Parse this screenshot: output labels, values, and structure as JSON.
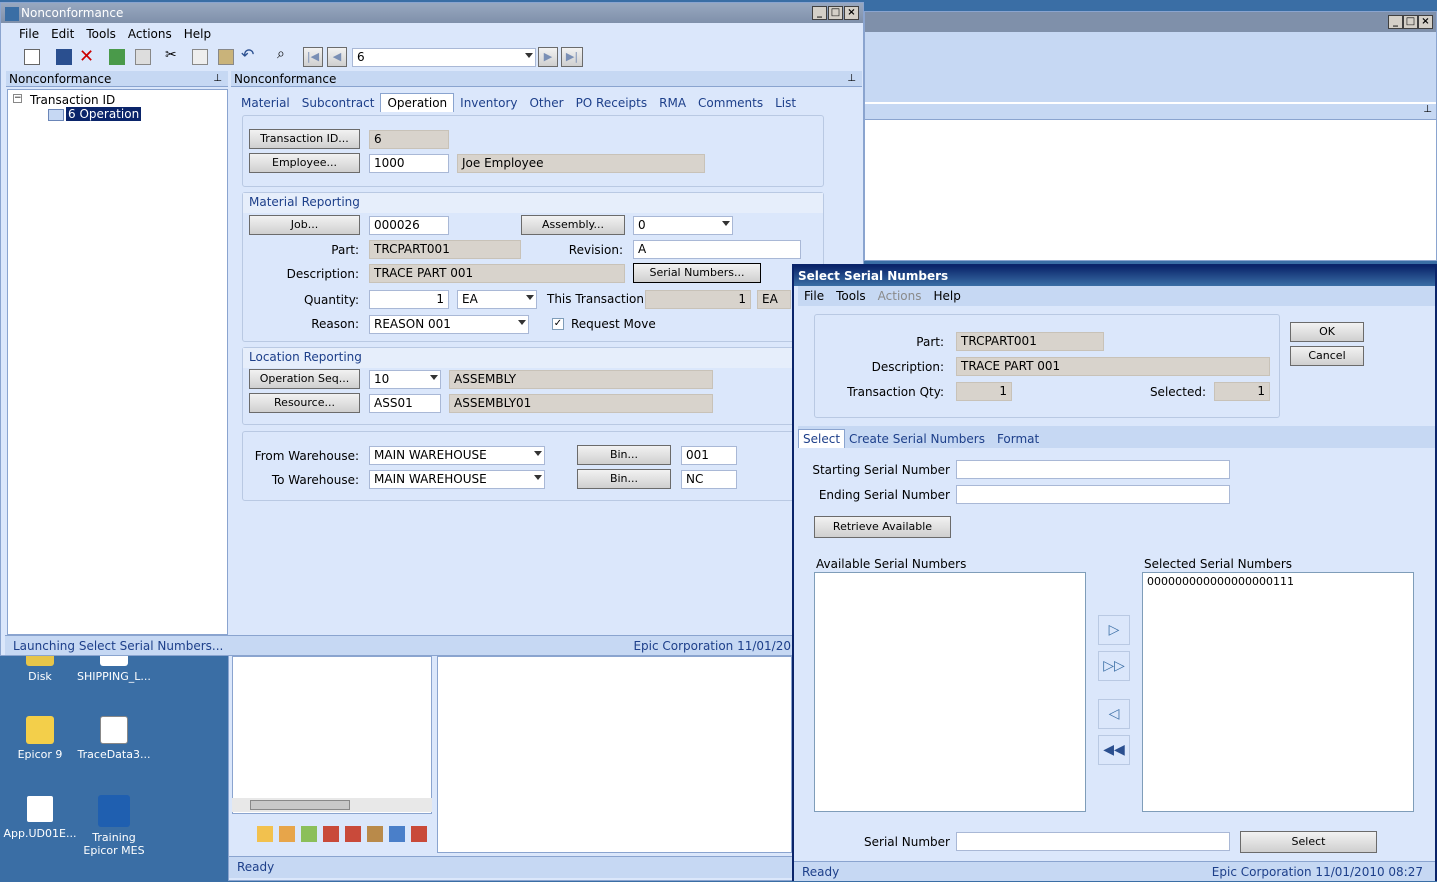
{
  "desktop": {
    "icons": [
      {
        "label": "Disk"
      },
      {
        "label": "SHIPPING_L..."
      },
      {
        "label": "Epicor 9"
      },
      {
        "label": "TraceData3..."
      },
      {
        "label": "App.UD01E..."
      },
      {
        "label": "Training Epicor MES"
      }
    ]
  },
  "main_window": {
    "title": "Nonconformance",
    "menu": [
      "File",
      "Edit",
      "Tools",
      "Actions",
      "Help"
    ],
    "toolbar": {
      "record_value": "6"
    },
    "tree_panel": {
      "title": "Nonconformance",
      "root": "Transaction ID",
      "child": "6 Operation"
    },
    "form_panel": {
      "title": "Nonconformance",
      "tabs": [
        "Material",
        "Subcontract",
        "Operation",
        "Inventory",
        "Other",
        "PO Receipts",
        "RMA",
        "Comments",
        "List"
      ],
      "active_tab": "Operation",
      "transaction_id_button": "Transaction ID...",
      "transaction_id": "6",
      "employee_button": "Employee...",
      "employee_id": "1000",
      "employee_name": "Joe Employee",
      "material_reporting": {
        "header": "Material Reporting",
        "job_button": "Job...",
        "job": "000026",
        "assembly_button": "Assembly...",
        "assembly": "0",
        "part_label": "Part:",
        "part": "TRCPART001",
        "revision_label": "Revision:",
        "revision": "A",
        "description_label": "Description:",
        "description": "TRACE PART 001",
        "serial_numbers_button": "Serial Numbers...",
        "quantity_label": "Quantity:",
        "quantity": "1",
        "uom": "EA",
        "this_transaction_label": "This Transaction:",
        "this_transaction": "1",
        "this_transaction_uom": "EA",
        "reason_label": "Reason:",
        "reason": "REASON 001",
        "request_move_label": "Request Move"
      },
      "location_reporting": {
        "header": "Location Reporting",
        "opseq_button": "Operation Seq...",
        "opseq": "10",
        "opseq_desc": "ASSEMBLY",
        "resource_button": "Resource...",
        "resource": "ASS01",
        "resource_desc": "ASSEMBLY01"
      },
      "warehouse": {
        "from_label": "From Warehouse:",
        "from": "MAIN WAREHOUSE",
        "to_label": "To Warehouse:",
        "to": "MAIN WAREHOUSE",
        "bin_button": "Bin...",
        "from_bin": "001",
        "to_bin": "NC"
      }
    },
    "status": {
      "left": "Launching Select Serial Numbers...",
      "right": "Epic Corporation   11/01/20"
    }
  },
  "bg_window": {
    "status": "Ready"
  },
  "dialog": {
    "title": "Select Serial Numbers",
    "menu": [
      "File",
      "Tools",
      "Actions",
      "Help"
    ],
    "part_label": "Part:",
    "part": "TRCPART001",
    "description_label": "Description:",
    "description": "TRACE PART 001",
    "txn_qty_label": "Transaction Qty:",
    "txn_qty": "1",
    "selected_label": "Selected:",
    "selected": "1",
    "ok": "OK",
    "cancel": "Cancel",
    "tabs": [
      "Select",
      "Create Serial Numbers",
      "Format"
    ],
    "starting_label": "Starting Serial Number",
    "ending_label": "Ending Serial Number",
    "retrieve_button": "Retrieve Available",
    "available_label": "Available Serial Numbers",
    "selected_list_label": "Selected Serial Numbers",
    "selected_items": [
      "000000000000000000111"
    ],
    "serial_number_label": "Serial Number",
    "select_button": "Select",
    "status_left": "Ready",
    "status_right": "Epic Corporation   11/01/2010  08:27"
  }
}
